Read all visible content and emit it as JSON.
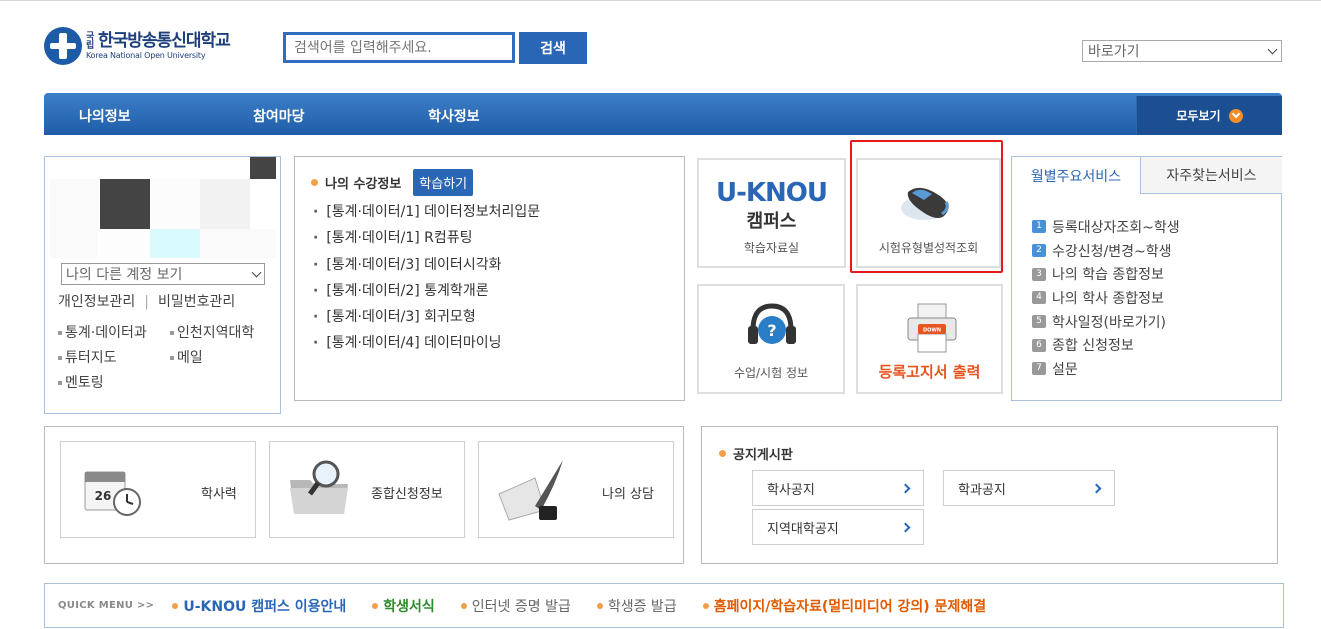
{
  "header": {
    "logo_kr_small": "국립",
    "logo_kr": "한국방송통신대학교",
    "logo_en": "Korea National Open University",
    "search_placeholder": "검색어를 입력해주세요.",
    "search_button": "검색",
    "quicklink_select": "바로가기"
  },
  "nav": {
    "items": [
      "나의정보",
      "참여마당",
      "학사정보"
    ],
    "view_all": "모두보기"
  },
  "user_panel": {
    "account_select": "나의 다른 계정 보기",
    "links": [
      "개인정보관리",
      "비밀번호관리"
    ],
    "list": [
      "통계·데이터과",
      "인천지역대학",
      "튜터지도",
      "메일",
      "멘토링"
    ]
  },
  "course": {
    "title": "나의 수강정보",
    "study_button": "학습하기",
    "items": [
      "[통계·데이터/1] 데이터정보처리입문",
      "[통계·데이터/1] R컴퓨팅",
      "[통계·데이터/3] 데이터시각화",
      "[통계·데이터/2] 통계학개론",
      "[통계·데이터/3] 회귀모형",
      "[통계·데이터/4] 데이터마이닝"
    ]
  },
  "tiles": {
    "uknou_logo": "U-KNOU",
    "uknou_sub": "캠퍼스",
    "uknou_label": "학습자료실",
    "exam_label": "시험유형별성적조회",
    "info_label": "수업/시험 정보",
    "print_label": "등록고지서 출력",
    "print_badge": "DOWN"
  },
  "services": {
    "tab_active": "월별주요서비스",
    "tab_inactive": "자주찾는서비스",
    "items": [
      {
        "num": "1",
        "label": "등록대상자조회~학생",
        "color": "#4a90d9"
      },
      {
        "num": "2",
        "label": "수강신청/변경~학생",
        "color": "#4a90d9"
      },
      {
        "num": "3",
        "label": "나의 학습 종합정보",
        "color": "#999999"
      },
      {
        "num": "4",
        "label": "나의 학사 종합정보",
        "color": "#999999"
      },
      {
        "num": "5",
        "label": "학사일정(바로가기)",
        "color": "#999999"
      },
      {
        "num": "6",
        "label": "종합 신청정보",
        "color": "#999999"
      },
      {
        "num": "7",
        "label": "설문",
        "color": "#999999"
      }
    ]
  },
  "quick_boxes": [
    "학사력",
    "종합신청정보",
    "나의 상담"
  ],
  "calendar_day": "26",
  "notice": {
    "title": "공지게시판",
    "buttons": [
      "학사공지",
      "학과공지",
      "지역대학공지"
    ]
  },
  "quick_menu": {
    "title": "QUICK MENU >>",
    "items": [
      {
        "label": "U-KNOU 캠퍼스 이용안내",
        "color": "#2a66b6",
        "bold": true
      },
      {
        "label": "학생서식",
        "color": "#2e8b2e",
        "bold": true
      },
      {
        "label": "인터넷 증명 발급",
        "color": "#666666",
        "bold": false
      },
      {
        "label": "학생증 발급",
        "color": "#666666",
        "bold": false
      },
      {
        "label": "홈페이지/학습자료(멀티미디어 강의) 문제해결",
        "color": "#e05a00",
        "bold": true
      }
    ]
  }
}
